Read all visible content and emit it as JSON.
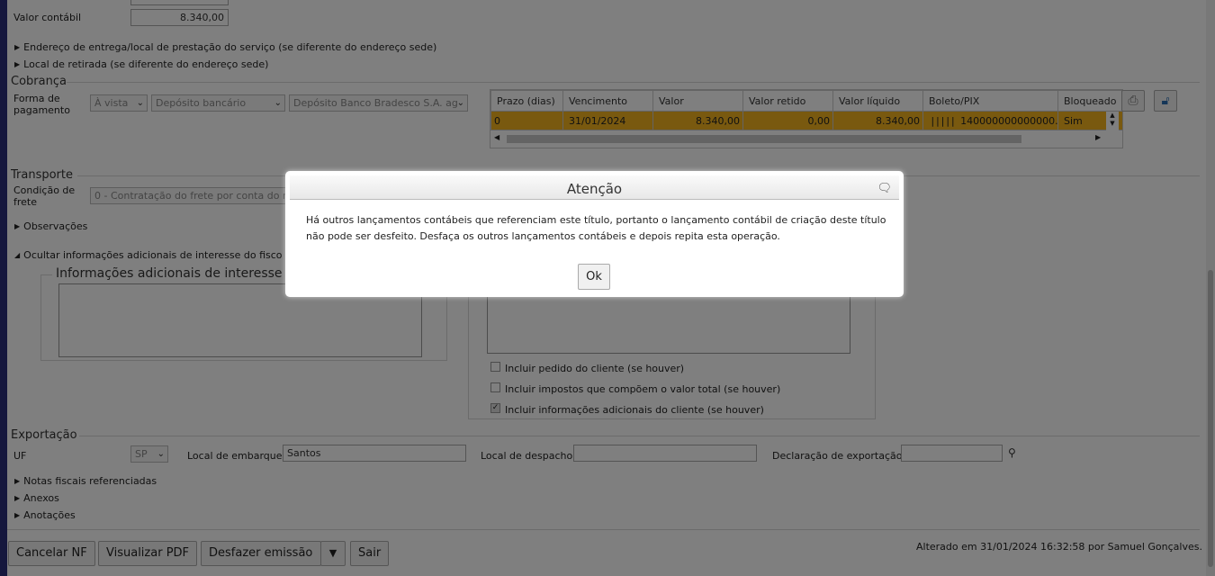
{
  "top": {
    "valor_contabil_label": "Valor contábil",
    "valor_contabil_value": "8.340,00",
    "endereco_entrega": "Endereço de entrega/local de prestação do serviço (se diferente do endereço sede)",
    "local_retirada": "Local de retirada (se diferente do endereço sede)"
  },
  "cobranca": {
    "section_title": "Cobrança",
    "forma_pagamento_label": "Forma de pagamento",
    "select1": "À vista",
    "select2": "Depósito bancário",
    "select3": "Depósito Banco Bradesco S.A. ag",
    "table": {
      "headers": [
        "Prazo (dias)",
        "Vencimento",
        "Valor",
        "Valor retido",
        "Valor líquido",
        "Boleto/PIX",
        "Bloqueado"
      ],
      "rows": [
        {
          "prazo": "0",
          "vencimento": "31/01/2024",
          "valor": "8.340,00",
          "retido": "0,00",
          "liquido": "8.340,00",
          "boleto": "140000000000000...",
          "bloqueado": "Sim"
        }
      ]
    }
  },
  "transporte": {
    "section_title": "Transporte",
    "condicao_label": "Condição de frete",
    "condicao_value": "0 - Contratação do frete por conta do re",
    "observacoes": "Observações",
    "ocultar": "Ocultar informações adicionais de interesse do fisco e",
    "info_fisco_legend": "Informações adicionais de interesse do",
    "checks": [
      {
        "label": "Incluir pedido do cliente (se houver)",
        "checked": false
      },
      {
        "label": "Incluir impostos que compõem o valor total (se houver)",
        "checked": false
      },
      {
        "label": "Incluir informações adicionais do cliente (se houver)",
        "checked": true
      }
    ]
  },
  "exportacao": {
    "section_title": "Exportação",
    "uf_label": "UF",
    "uf_value": "SP",
    "local_embarque_label": "Local de embarque",
    "local_embarque_value": "Santos",
    "local_despacho_label": "Local de despacho",
    "local_despacho_value": "",
    "declaracao_label": "Declaração de exportação",
    "declaracao_value": ""
  },
  "links": {
    "notas": "Notas fiscais referenciadas",
    "anexos": "Anexos",
    "anotacoes": "Anotações"
  },
  "footer": {
    "cancelar": "Cancelar NF",
    "visualizar": "Visualizar PDF",
    "desfazer": "Desfazer emissão",
    "sair": "Sair",
    "alterado": "Alterado em 31/01/2024 16:32:58 por Samuel Gonçalves."
  },
  "dialog": {
    "title": "Atenção",
    "message": "Há outros lançamentos contábeis que referenciam este título, portanto o lançamento contábil de criação deste título não pode ser desfeito. Desfaça os outros lançamentos contábeis e depois repita esta operação.",
    "ok": "Ok"
  },
  "colors": {
    "highlight_row": "#f3b31e",
    "overlay": "rgba(0,0,0,0.5)",
    "left_strip": "#2a2f7a"
  }
}
